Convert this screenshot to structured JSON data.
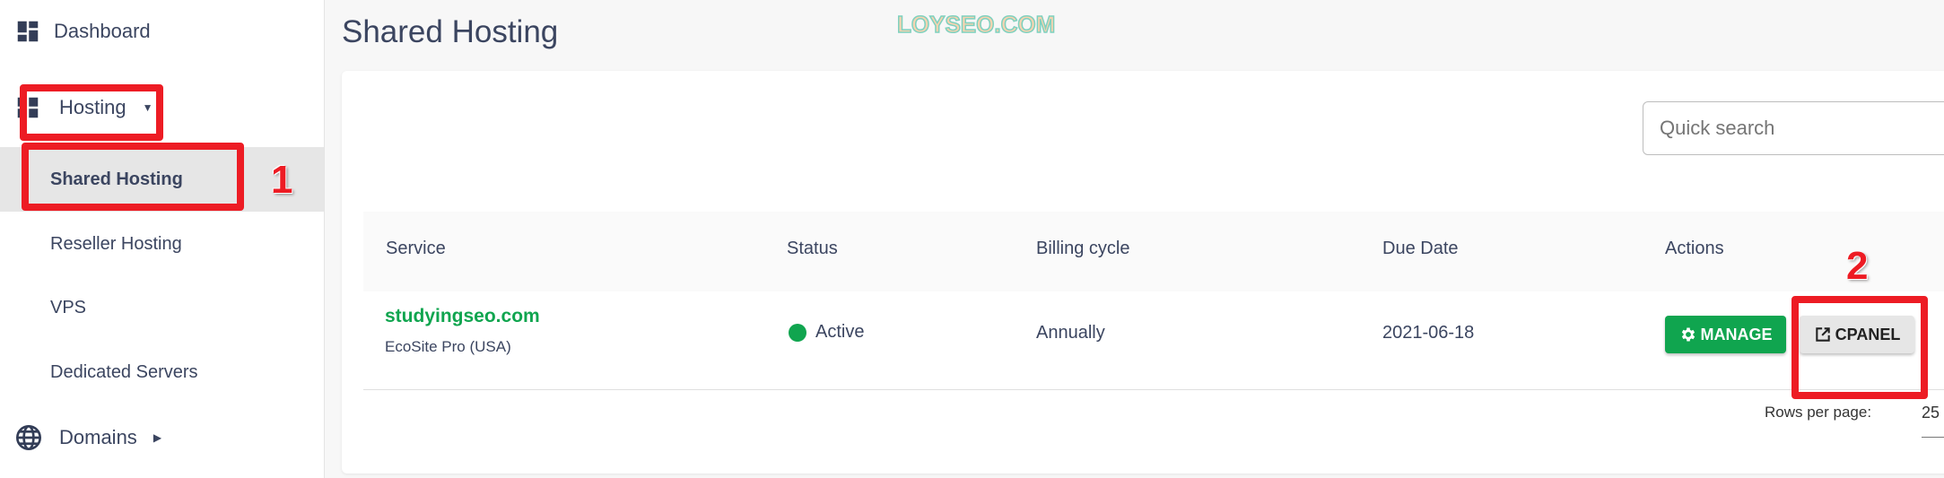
{
  "sidebar": {
    "dashboard": "Dashboard",
    "hosting": "Hosting",
    "hosting_items": [
      "Shared Hosting",
      "Reseller Hosting",
      "VPS",
      "Dedicated Servers"
    ],
    "domains": "Domains"
  },
  "page_title": "Shared Hosting",
  "watermark": "LOYSEO.COM",
  "search": {
    "placeholder": "Quick search",
    "value": ""
  },
  "table": {
    "columns": [
      "Service",
      "Status",
      "Billing cycle",
      "Due Date",
      "Actions"
    ],
    "rows": [
      {
        "service": "studyingseo.com",
        "plan": "EcoSite Pro (USA)",
        "status": "Active",
        "billing": "Annually",
        "due": "2021-06-18",
        "actions": [
          "MANAGE",
          "CPANEL"
        ]
      }
    ]
  },
  "pagination": {
    "rows_per_page_label": "Rows per page:",
    "rows_per_page": "25"
  },
  "annotations": [
    "1",
    "2"
  ],
  "colors": {
    "accent": "#10a54f",
    "annotation": "#ed1c24",
    "text": "#3b4560"
  }
}
